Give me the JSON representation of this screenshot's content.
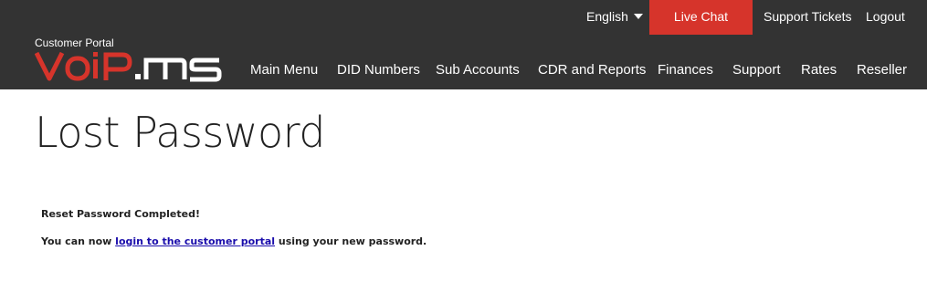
{
  "header": {
    "logo_caption": "Customer Portal",
    "logo_text": "VoIP.ms",
    "top_links": {
      "language": "English",
      "live_chat": "Live Chat",
      "support_tickets": "Support Tickets",
      "logout": "Logout"
    },
    "nav": [
      {
        "label": "Main Menu"
      },
      {
        "label": "DID Numbers"
      },
      {
        "label": "Sub Accounts"
      },
      {
        "label": "CDR and Reports"
      },
      {
        "label": "Finances"
      },
      {
        "label": "Support"
      },
      {
        "label": "Rates"
      },
      {
        "label": "Reseller"
      }
    ]
  },
  "main": {
    "title": "Lost Password",
    "status_line": "Reset Password Completed!",
    "message": {
      "prefix": "You can now ",
      "link_text": "login to the customer portal",
      "suffix": " using your new password."
    }
  },
  "colors": {
    "header_bg": "#333333",
    "accent_red": "#d6342b",
    "link": "#1a0dab"
  }
}
